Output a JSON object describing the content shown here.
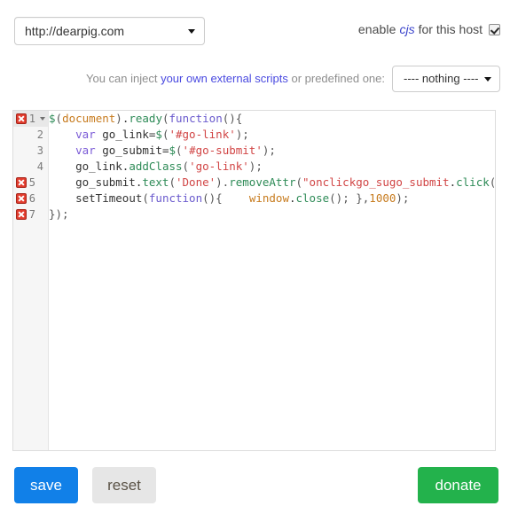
{
  "host_row": {
    "select_name": "host-select",
    "selected_host": "http://dearpig.com",
    "enable_prefix": "enable",
    "enable_keyword": "cjs",
    "enable_suffix": "for this host",
    "enable_checked": true
  },
  "inject_row": {
    "text_before": "You can inject ",
    "link_text": "your own external scripts",
    "text_after": " or predefined one:",
    "predefined_selected": "---- nothing ----"
  },
  "editor": {
    "lines": [
      {
        "number": "1",
        "error": true,
        "fold": true,
        "active": true,
        "tokens": [
          {
            "text": "$",
            "cls": "t-dollar"
          },
          {
            "text": "(",
            "cls": "t-punc"
          },
          {
            "text": "document",
            "cls": "t-obj"
          },
          {
            "text": ")",
            "cls": "t-punc"
          },
          {
            "text": ".",
            "cls": "t-def"
          },
          {
            "text": "ready",
            "cls": "t-meth"
          },
          {
            "text": "(",
            "cls": "t-punc"
          },
          {
            "text": "function",
            "cls": "t-kw"
          },
          {
            "text": "(){",
            "cls": "t-punc"
          }
        ]
      },
      {
        "number": "2",
        "error": false,
        "fold": false,
        "active": false,
        "tokens": [
          {
            "text": "    ",
            "cls": "t-def"
          },
          {
            "text": "var",
            "cls": "t-var"
          },
          {
            "text": " go_link=",
            "cls": "t-def"
          },
          {
            "text": "$",
            "cls": "t-dollar"
          },
          {
            "text": "(",
            "cls": "t-punc"
          },
          {
            "text": "'#go-link'",
            "cls": "t-str"
          },
          {
            "text": ");",
            "cls": "t-punc"
          }
        ]
      },
      {
        "number": "3",
        "error": false,
        "fold": false,
        "active": false,
        "tokens": [
          {
            "text": "    ",
            "cls": "t-def"
          },
          {
            "text": "var",
            "cls": "t-var"
          },
          {
            "text": " go_submit=",
            "cls": "t-def"
          },
          {
            "text": "$",
            "cls": "t-dollar"
          },
          {
            "text": "(",
            "cls": "t-punc"
          },
          {
            "text": "'#go-submit'",
            "cls": "t-str"
          },
          {
            "text": ");",
            "cls": "t-punc"
          }
        ]
      },
      {
        "number": "4",
        "error": false,
        "fold": false,
        "active": false,
        "tokens": [
          {
            "text": "    go_link.",
            "cls": "t-def"
          },
          {
            "text": "addClass",
            "cls": "t-meth"
          },
          {
            "text": "(",
            "cls": "t-punc"
          },
          {
            "text": "'go-link'",
            "cls": "t-str"
          },
          {
            "text": ");",
            "cls": "t-punc"
          }
        ]
      },
      {
        "number": "5",
        "error": true,
        "fold": false,
        "active": false,
        "tokens": [
          {
            "text": "    go_submit.",
            "cls": "t-def"
          },
          {
            "text": "text",
            "cls": "t-meth"
          },
          {
            "text": "(",
            "cls": "t-punc"
          },
          {
            "text": "'Done'",
            "cls": "t-str"
          },
          {
            "text": ").",
            "cls": "t-punc"
          },
          {
            "text": "removeAttr",
            "cls": "t-meth"
          },
          {
            "text": "(",
            "cls": "t-punc"
          },
          {
            "text": "\"onclickgo_sugo_submit",
            "cls": "t-str"
          },
          {
            "text": ".",
            "cls": "t-def"
          },
          {
            "text": "click",
            "cls": "t-meth"
          },
          {
            "text": "();",
            "cls": "t-punc"
          }
        ]
      },
      {
        "number": "6",
        "error": true,
        "fold": false,
        "active": false,
        "tokens": [
          {
            "text": "    ",
            "cls": "t-def"
          },
          {
            "text": "setTimeout",
            "cls": "t-def"
          },
          {
            "text": "(",
            "cls": "t-punc"
          },
          {
            "text": "function",
            "cls": "t-kw"
          },
          {
            "text": "(){    ",
            "cls": "t-punc"
          },
          {
            "text": "window",
            "cls": "t-obj"
          },
          {
            "text": ".",
            "cls": "t-def"
          },
          {
            "text": "close",
            "cls": "t-meth"
          },
          {
            "text": "(); },",
            "cls": "t-punc"
          },
          {
            "text": "1000",
            "cls": "t-num"
          },
          {
            "text": ");",
            "cls": "t-punc"
          }
        ]
      },
      {
        "number": "7",
        "error": true,
        "fold": false,
        "active": false,
        "tokens": [
          {
            "text": "});",
            "cls": "t-punc"
          }
        ]
      }
    ]
  },
  "buttons": {
    "save": "save",
    "reset": "reset",
    "donate": "donate"
  },
  "colors": {
    "save_bg": "#1180e8",
    "reset_bg": "#e6e6e6",
    "donate_bg": "#23b24c",
    "link": "#4a4ae0",
    "error_marker": "#e23c2e"
  }
}
